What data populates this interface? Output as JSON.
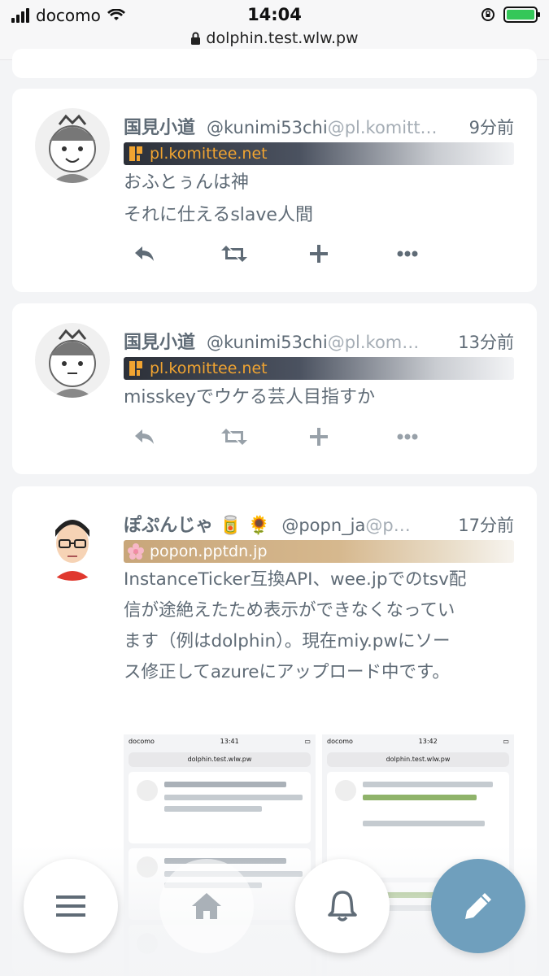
{
  "status_bar": {
    "carrier": "docomo",
    "time": "14:04",
    "url": "dolphin.test.wlw.pw"
  },
  "notes": [
    {
      "name": "国見小道",
      "acct_user": "@kunimi53chi",
      "acct_host": "@pl.komitt…",
      "time": "9分前",
      "instance": "pl.komittee.net",
      "lines": [
        "おふとぅんは神",
        "それに仕えるslave人間"
      ]
    },
    {
      "name": "国見小道",
      "acct_user": "@kunimi53chi",
      "acct_host": "@pl.kom…",
      "time": "13分前",
      "instance": "pl.komittee.net",
      "lines": [
        "misskeyでウケる芸人目指すか"
      ]
    },
    {
      "name": "ぽぷんじゃ 🥫 🌻",
      "acct_user": "@popn_ja",
      "acct_host": "@p…",
      "time": "17分前",
      "instance": "popon.pptdn.jp",
      "lines": [
        "InstanceTicker互換API、wee.jpでのtsv配",
        "信が途絶えたため表示ができなくなってい",
        "ます（例はdolphin）。現在miy.pwにソー",
        "ス修正してazureにアップロード中です。"
      ]
    }
  ],
  "attachment": {
    "left": {
      "time": "13:41",
      "url": "dolphin.test.wlw.pw",
      "carrier": "docomo"
    },
    "right": {
      "time": "13:42",
      "url": "dolphin.test.wlw.pw",
      "carrier": "docomo"
    }
  },
  "colors": {
    "compose_fab": "#6f9fbd",
    "ticker_text_komittee": "#f1a431",
    "text": "#5f6b76"
  },
  "icons": [
    "reply-icon",
    "renote-icon",
    "plus-icon",
    "more-icon",
    "menu-icon",
    "home-icon",
    "bell-icon",
    "pencil-icon"
  ]
}
